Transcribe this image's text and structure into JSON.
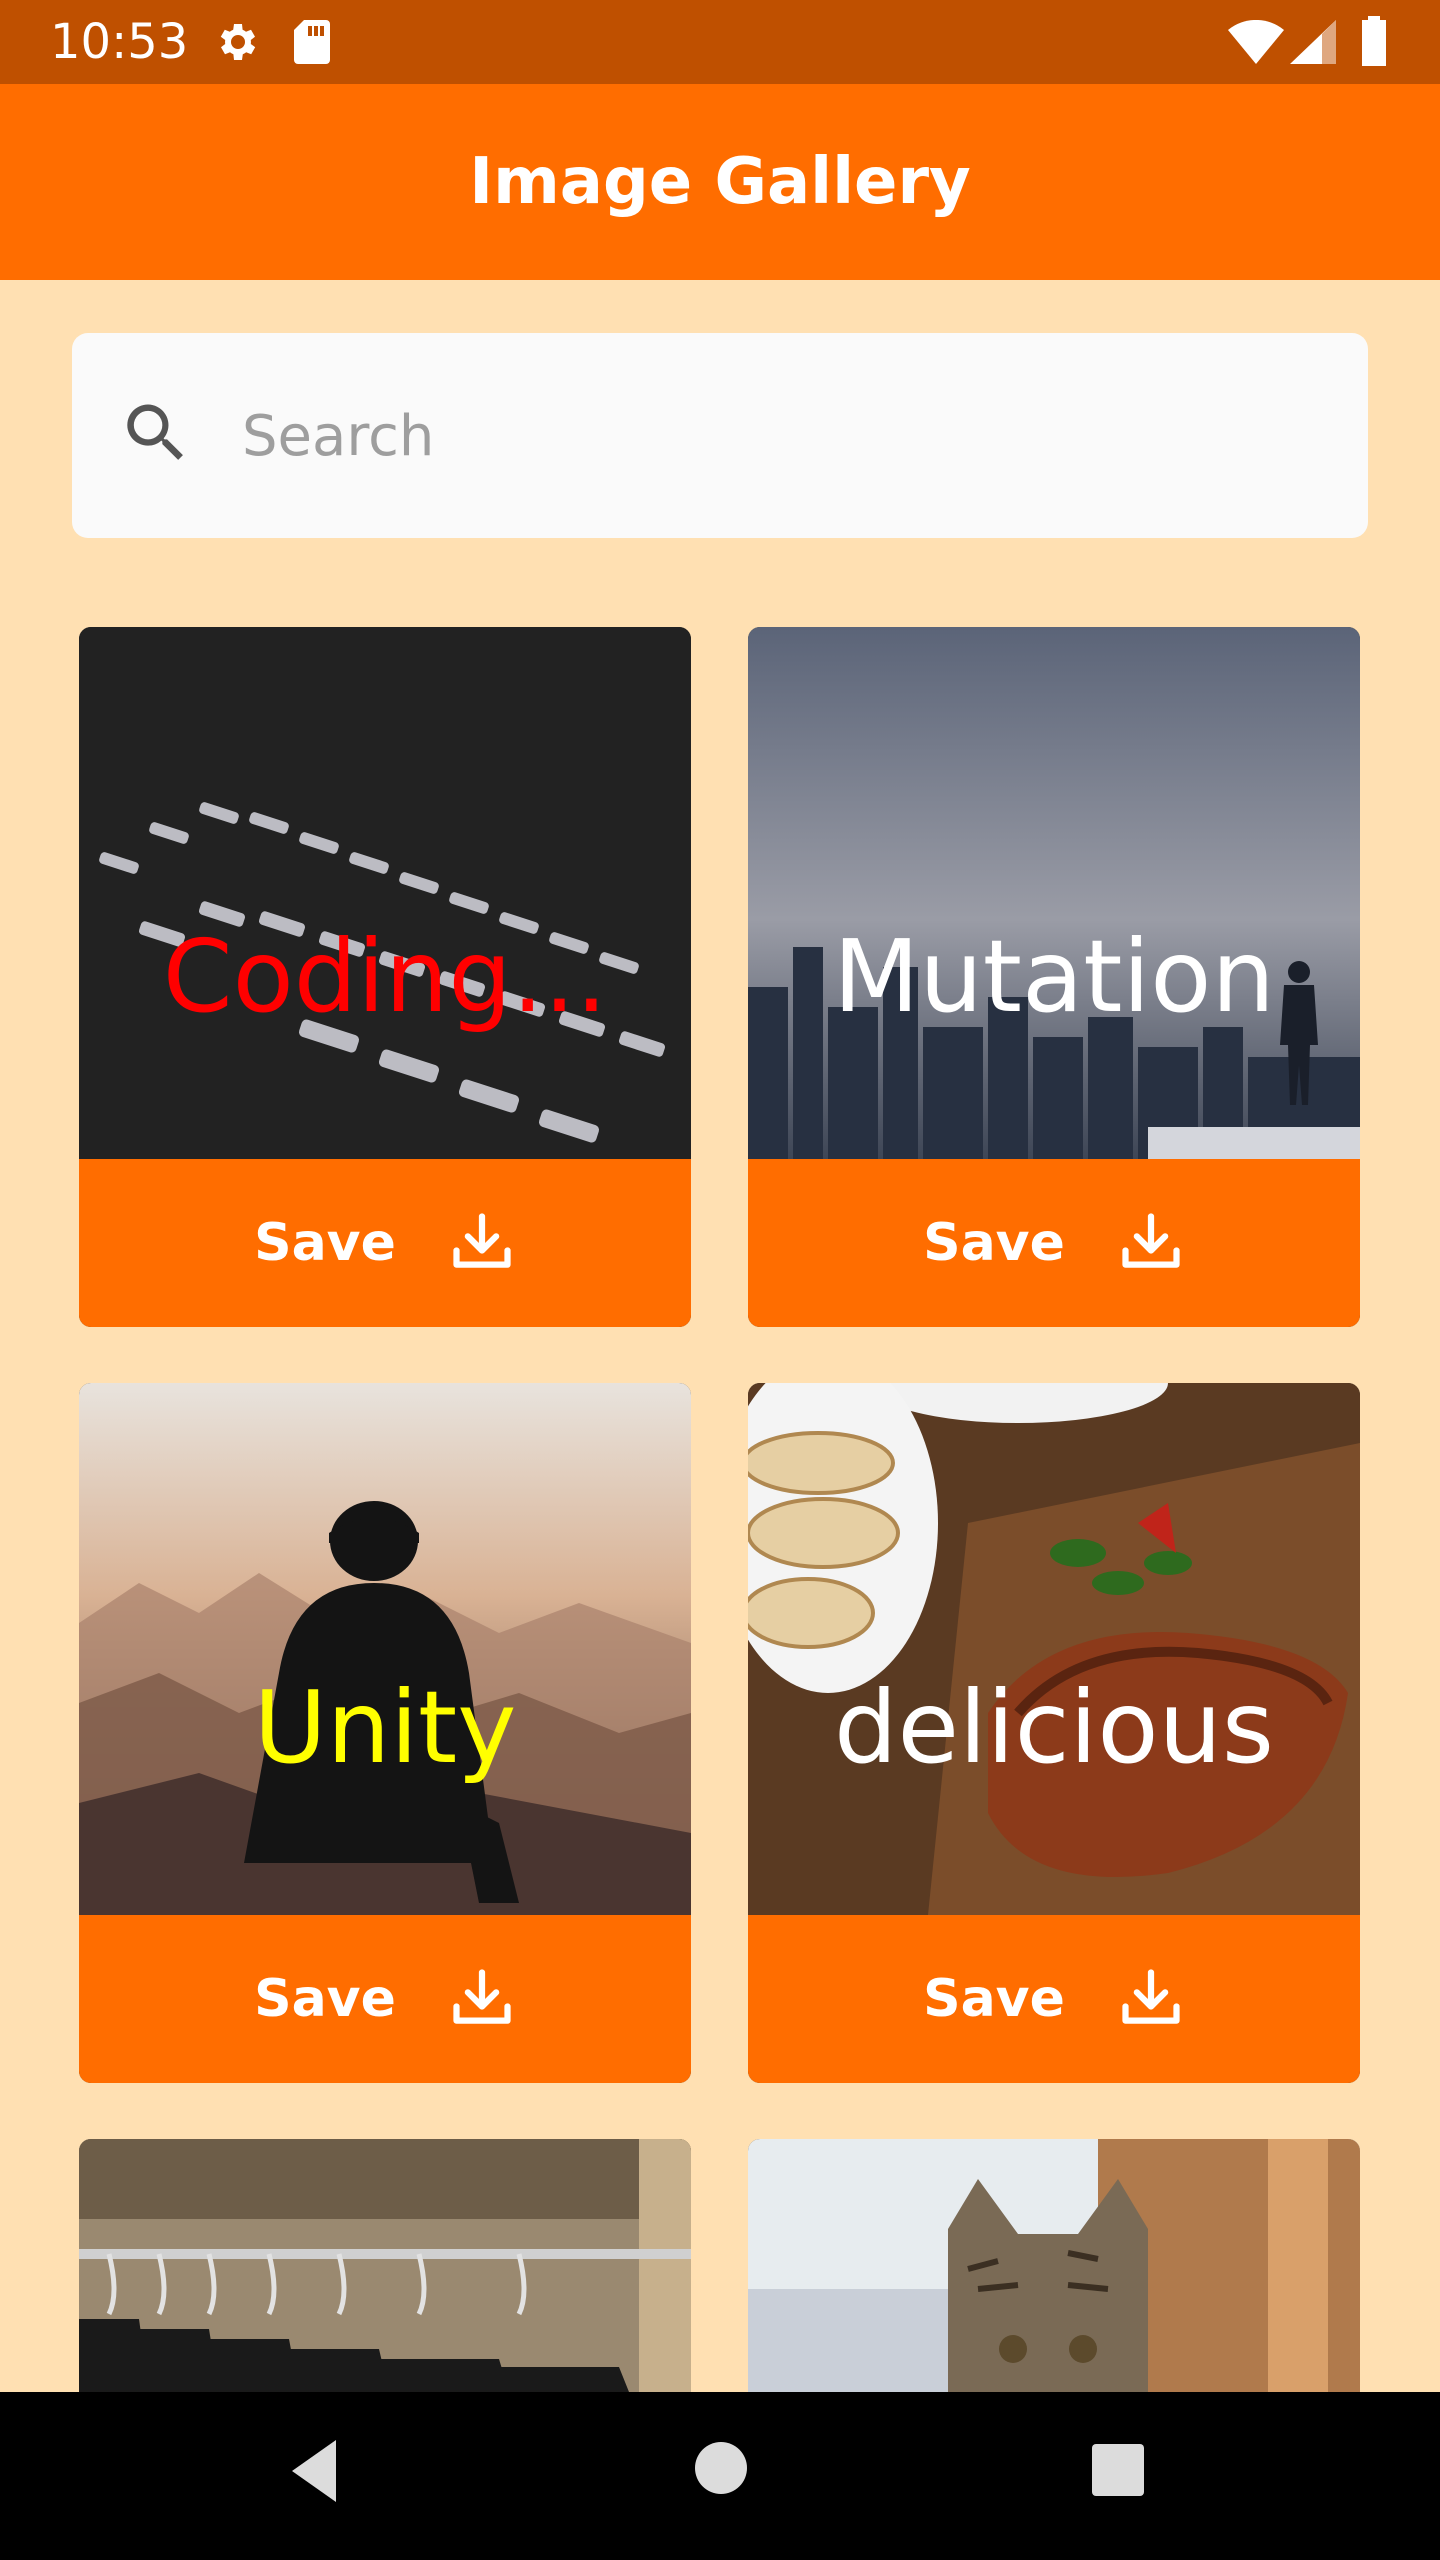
{
  "status_bar": {
    "time": "10:53",
    "icons": [
      "settings-icon",
      "sd-card-icon",
      "wifi-icon",
      "signal-icon",
      "battery-icon"
    ]
  },
  "app_bar": {
    "title": "Image Gallery"
  },
  "search": {
    "placeholder": "Search",
    "value": ""
  },
  "cards": [
    {
      "caption": "Coding...",
      "caption_color": "#FF0000",
      "image": "keyboard-photo",
      "save_label": "Save"
    },
    {
      "caption": "Mutation",
      "caption_color": "#FFFFFF",
      "image": "city-skyline-photo",
      "save_label": "Save"
    },
    {
      "caption": "Unity",
      "caption_color": "#FFFF00",
      "image": "person-mountains-photo",
      "save_label": "Save"
    },
    {
      "caption": "delicious",
      "caption_color": "#FFFFFF",
      "image": "steak-bread-photo",
      "save_label": "Save"
    },
    {
      "caption": "",
      "image": "clothes-hangers-photo",
      "save_label": ""
    },
    {
      "caption": "",
      "image": "kitten-photo",
      "save_label": ""
    }
  ],
  "colors": {
    "accent": "#FF6D00",
    "status_bar": "#BF5000",
    "background": "#FFE0B2",
    "search_bg": "#FAFAFA"
  }
}
